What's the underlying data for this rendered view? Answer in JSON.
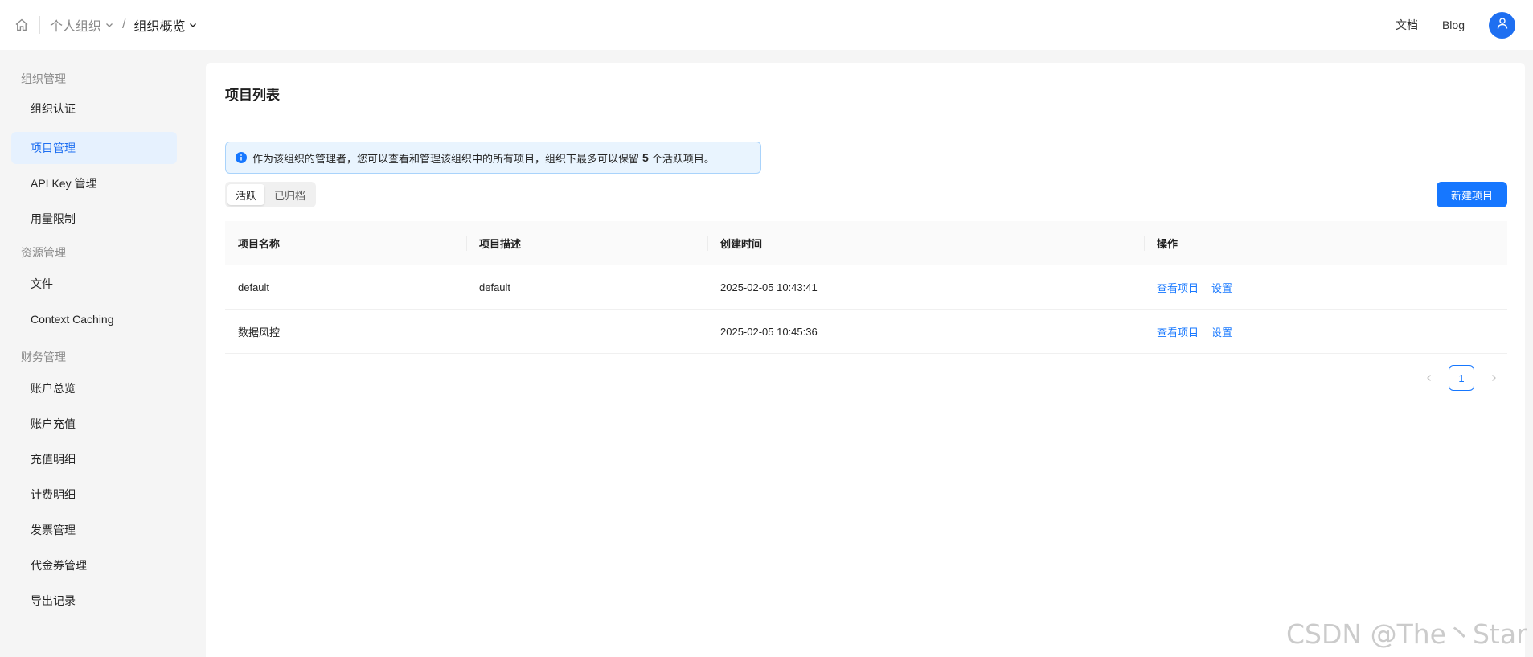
{
  "topbar": {
    "org_crumb": "个人组织",
    "crumb_separator": "/",
    "page_crumb": "组织概览",
    "docs_link": "文档",
    "blog_link": "Blog"
  },
  "sidebar": {
    "groups": [
      {
        "title": "组织管理",
        "items": [
          "组织认证",
          "项目管理",
          "API Key 管理",
          "用量限制"
        ]
      },
      {
        "title": "资源管理",
        "items": [
          "文件",
          "Context Caching"
        ]
      },
      {
        "title": "财务管理",
        "items": [
          "账户总览",
          "账户充值",
          "充值明细",
          "计费明细",
          "发票管理",
          "代金券管理",
          "导出记录"
        ]
      }
    ],
    "active_item": "项目管理"
  },
  "main": {
    "title": "项目列表",
    "notice": {
      "before": "作为该组织的管理者，您可以查看和管理该组织中的所有项目，组织下最多可以保留",
      "count": "5",
      "after": "个活跃项目。"
    },
    "tabs": [
      {
        "label": "活跃",
        "active": true
      },
      {
        "label": "已归档",
        "active": false
      }
    ],
    "new_button": "新建项目",
    "table": {
      "columns": [
        "项目名称",
        "项目描述",
        "创建时间",
        "操作"
      ],
      "rows": [
        {
          "name": "default",
          "description": "default",
          "created": "2025-02-05 10:43:41",
          "actions": [
            "查看项目",
            "设置"
          ]
        },
        {
          "name": "数据风控",
          "description": "",
          "created": "2025-02-05 10:45:36",
          "actions": [
            "查看项目",
            "设置"
          ]
        }
      ]
    },
    "pagination": {
      "current_page": "1"
    }
  },
  "watermark": "CSDN @The丶Star",
  "colors": {
    "primary": "#1677ff",
    "avatar": "#1e6ff1",
    "active_nav_bg": "#e6f1fe",
    "notice_bg": "#e9f4fe"
  },
  "icons": {
    "home": "home-icon",
    "chevron": "chevron-down-icon",
    "user": "user-icon",
    "info": "info-icon",
    "prev": "chevron-left-icon",
    "next": "chevron-right-icon"
  }
}
